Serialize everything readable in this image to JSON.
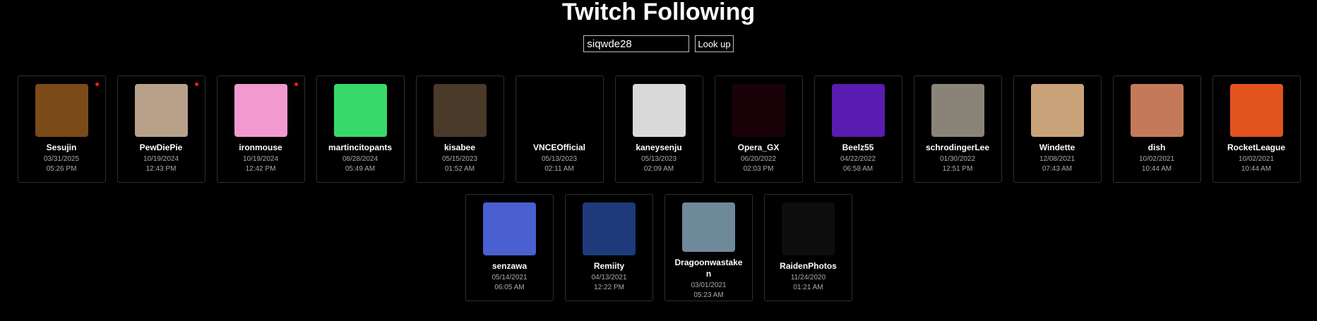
{
  "header": {
    "title": "Twitch Following"
  },
  "search": {
    "value": "siqwde28",
    "button_label": "Look up"
  },
  "channels": [
    {
      "name": "Sesujin",
      "date": "03/31/2025",
      "time": "05:26 PM",
      "live": true,
      "avatar_color": "#7a4a18",
      "icon": "barrel-avatar"
    },
    {
      "name": "PewDiePie",
      "date": "10/19/2024",
      "time": "12:43 PM",
      "live": true,
      "avatar_color": "#b9a08a",
      "icon": "person-avatar"
    },
    {
      "name": "ironmouse",
      "date": "10/19/2024",
      "time": "12:42 PM",
      "live": true,
      "avatar_color": "#f29ad0",
      "icon": "anime-avatar"
    },
    {
      "name": "martincitopants",
      "date": "08/28/2024",
      "time": "05:49 AM",
      "live": false,
      "avatar_color": "#38d96b",
      "icon": "frog-avatar"
    },
    {
      "name": "kisabee",
      "date": "05/15/2023",
      "time": "01:52 AM",
      "live": false,
      "avatar_color": "#4a3a2a",
      "icon": "anime-avatar"
    },
    {
      "name": "VNCEOfficial",
      "date": "05/13/2023",
      "time": "02:11 AM",
      "live": false,
      "avatar_color": "#000000",
      "icon": "logo-avatar"
    },
    {
      "name": "kaneysenju",
      "date": "05/13/2023",
      "time": "02:09 AM",
      "live": false,
      "avatar_color": "#d9d9d9",
      "icon": "anime-avatar"
    },
    {
      "name": "Opera_GX",
      "date": "06/20/2022",
      "time": "02:03 PM",
      "live": false,
      "avatar_color": "#1a0308",
      "icon": "opera-avatar"
    },
    {
      "name": "Beelz55",
      "date": "04/22/2022",
      "time": "06:58 AM",
      "live": false,
      "avatar_color": "#5a1bb0",
      "icon": "letter-b-avatar"
    },
    {
      "name": "schrodingerLee",
      "date": "01/30/2022",
      "time": "12:51 PM",
      "live": false,
      "avatar_color": "#8a8478",
      "icon": "anime-avatar"
    },
    {
      "name": "Windette",
      "date": "12/08/2021",
      "time": "07:43 AM",
      "live": false,
      "avatar_color": "#c9a27a",
      "icon": "cartoon-avatar"
    },
    {
      "name": "dish",
      "date": "10/02/2021",
      "time": "10:44 AM",
      "live": false,
      "avatar_color": "#c47a5a",
      "icon": "person-avatar"
    },
    {
      "name": "RocketLeague",
      "date": "10/02/2021",
      "time": "10:44 AM",
      "live": false,
      "avatar_color": "#e2531e",
      "icon": "rocketleague-avatar"
    },
    {
      "name": "senzawa",
      "date": "05/14/2021",
      "time": "06:05 AM",
      "live": false,
      "avatar_color": "#4a5fd0",
      "icon": "anime-avatar"
    },
    {
      "name": "Remiity",
      "date": "04/13/2021",
      "time": "12:22 PM",
      "live": false,
      "avatar_color": "#1e3a7a",
      "icon": "crown-avatar"
    },
    {
      "name": "Dragoonwastaken",
      "date": "03/01/2021",
      "time": "05:23 AM",
      "live": false,
      "avatar_color": "#6e8a9a",
      "icon": "anime-avatar"
    },
    {
      "name": "RaidenPhotos",
      "date": "11/24/2020",
      "time": "01:21 AM",
      "live": false,
      "avatar_color": "#0d0d0d",
      "icon": "trollface-avatar"
    }
  ]
}
